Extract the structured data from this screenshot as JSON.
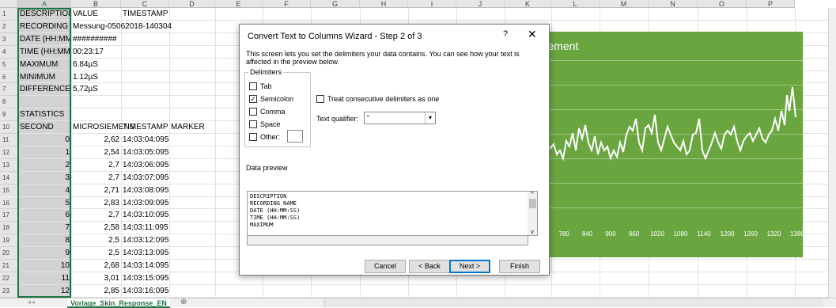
{
  "columns": [
    "A",
    "B",
    "C",
    "D",
    "E",
    "F",
    "G",
    "H",
    "I",
    "J",
    "K",
    "L",
    "M",
    "N",
    "O",
    "P"
  ],
  "rows": [
    {
      "n": "1",
      "a": "DESCRIPTION",
      "b": "VALUE",
      "c": "TIMESTAMP",
      "d": ""
    },
    {
      "n": "2",
      "a": "RECORDING",
      "b": "Messung-05062018-140304",
      "c": "",
      "d": ""
    },
    {
      "n": "3",
      "a": "DATE (HH:MM:SS)",
      "b": "##########",
      "c": "",
      "d": ""
    },
    {
      "n": "4",
      "a": "TIME (HH:MM:SS)",
      "b": "00:23:17",
      "c": "",
      "d": ""
    },
    {
      "n": "5",
      "a": "MAXIMUM",
      "b": "6.84µS",
      "c": "",
      "d": ""
    },
    {
      "n": "6",
      "a": "MINIMUM",
      "b": "1.12µS",
      "c": "",
      "d": ""
    },
    {
      "n": "7",
      "a": "DIFFERENCE",
      "b": "5,72µS",
      "c": "",
      "d": ""
    },
    {
      "n": "8",
      "a": "",
      "b": "",
      "c": "",
      "d": ""
    },
    {
      "n": "9",
      "a": "STATISTICS",
      "b": "",
      "c": "",
      "d": ""
    },
    {
      "n": "10",
      "a": "SECOND",
      "b": "MICROSIEMENS",
      "c": "TIMESTAMP",
      "d": "MARKER"
    },
    {
      "n": "11",
      "a": "0",
      "b": "2,62",
      "c": "14:03:04:095",
      "d": ""
    },
    {
      "n": "12",
      "a": "1",
      "b": "2,54",
      "c": "14:03:05:095",
      "d": ""
    },
    {
      "n": "13",
      "a": "2",
      "b": "2,7",
      "c": "14:03:06:095",
      "d": ""
    },
    {
      "n": "14",
      "a": "3",
      "b": "2,7",
      "c": "14:03:07:095",
      "d": ""
    },
    {
      "n": "15",
      "a": "4",
      "b": "2,71",
      "c": "14:03:08:095",
      "d": ""
    },
    {
      "n": "16",
      "a": "5",
      "b": "2,83",
      "c": "14:03:09:095",
      "d": ""
    },
    {
      "n": "17",
      "a": "6",
      "b": "2,7",
      "c": "14:03:10:095",
      "d": ""
    },
    {
      "n": "18",
      "a": "7",
      "b": "2,58",
      "c": "14:03:11:095",
      "d": ""
    },
    {
      "n": "19",
      "a": "8",
      "b": "2,5",
      "c": "14:03:12:095",
      "d": ""
    },
    {
      "n": "20",
      "a": "9",
      "b": "2,5",
      "c": "14:03:13:095",
      "d": ""
    },
    {
      "n": "21",
      "a": "10",
      "b": "2,68",
      "c": "14:03:14:095",
      "d": ""
    },
    {
      "n": "22",
      "a": "11",
      "b": "3,01",
      "c": "14:03:15:095",
      "d": ""
    },
    {
      "n": "23",
      "a": "12",
      "b": "2,85",
      "c": "14:03:16:095",
      "d": ""
    }
  ],
  "chart": {
    "title_partial": "urement",
    "x_ticks": [
      "780",
      "840",
      "900",
      "960",
      "1020",
      "1080",
      "1140",
      "1200",
      "1260",
      "1320",
      "1380"
    ],
    "background": "#6aa640"
  },
  "dialog": {
    "title": "Convert Text to Columns Wizard - Step 2 of 3",
    "help": "?",
    "close": "✕",
    "description": "This screen lets you set the delimiters your data contains.  You can see how your text is affected in the preview below.",
    "delimiters_label": "Delimiters",
    "delimiters": [
      {
        "label": "Tab",
        "checked": false
      },
      {
        "label": "Semicolon",
        "checked": true
      },
      {
        "label": "Comma",
        "checked": false
      },
      {
        "label": "Space",
        "checked": false
      },
      {
        "label": "Other:",
        "checked": false
      }
    ],
    "consecutive_label": "Treat consecutive delimiters as one",
    "qualifier_label": "Text qualifier:",
    "qualifier_value": "\"",
    "preview_label": "Data preview",
    "preview_lines": [
      "DESCRIPTION",
      "RECORDING NAME",
      "DATE (HH:MM:SS)",
      "TIME (HH:MM:SS)",
      "MAXIMUM"
    ],
    "buttons": {
      "cancel": "Cancel",
      "back": "< Back",
      "next": "Next >",
      "finish": "Finish"
    }
  },
  "sheet_tab": "Vorlage_Skin_Response_EN",
  "add_sheet": "⊕"
}
